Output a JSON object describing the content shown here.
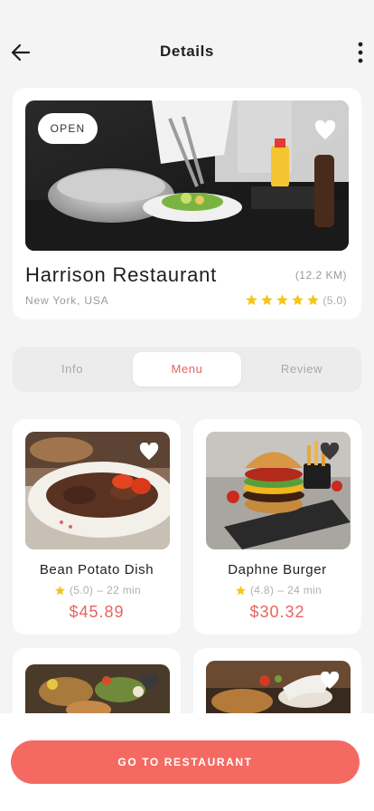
{
  "header": {
    "title": "Details",
    "back_icon": "arrow-left-icon",
    "more_icon": "more-vertical-icon"
  },
  "restaurant": {
    "status": "OPEN",
    "name": "Harrison Restaurant",
    "distance": "(12.2 KM)",
    "location": "New York, USA",
    "rating_text": "(5.0)",
    "rating": 5,
    "favorite_icon": "heart-icon"
  },
  "tabs": [
    {
      "label": "Info",
      "active": false
    },
    {
      "label": "Menu",
      "active": true
    },
    {
      "label": "Review",
      "active": false
    }
  ],
  "menu": [
    {
      "name": "Bean Potato Dish",
      "rating": "(5.0)",
      "time": "22 min",
      "price": "$45.89"
    },
    {
      "name": "Daphne Burger",
      "rating": "(4.8)",
      "time": "24 min",
      "price": "$30.32"
    }
  ],
  "cta": {
    "label": "GO TO RESTAURANT"
  },
  "colors": {
    "accent": "#f46a63",
    "price": "#e8645f",
    "star": "#f5c518",
    "background": "#f4f4f4"
  }
}
